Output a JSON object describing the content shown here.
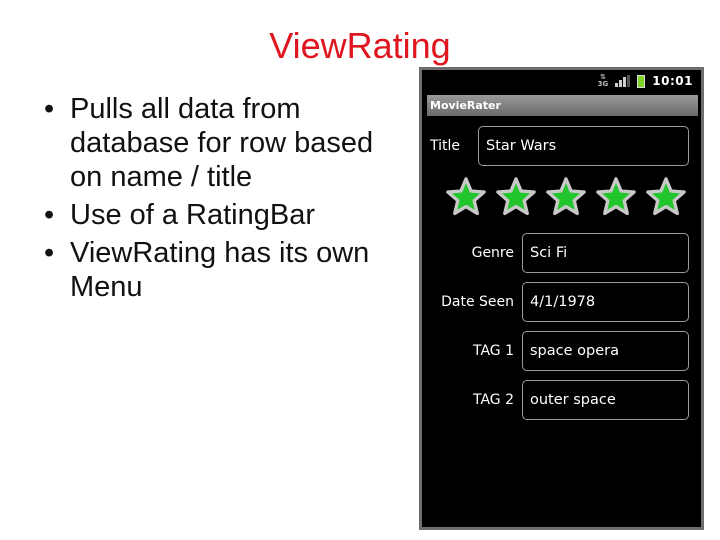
{
  "slide": {
    "title": "ViewRating",
    "bullet_glyph": "•",
    "bullets": [
      "Pulls all data from database for row based on name / title",
      "Use of a RatingBar",
      "ViewRating has its own Menu"
    ]
  },
  "phone": {
    "status_bar": {
      "network_label": "3G",
      "clock": "10:01"
    },
    "app_title": "MovieRater",
    "title_field": {
      "label": "Title",
      "value": "Star Wars"
    },
    "rating": {
      "value": 5,
      "max": 5,
      "star_color": "#22c52b"
    },
    "fields": [
      {
        "label": "Genre",
        "value": "Sci Fi"
      },
      {
        "label": "Date Seen",
        "value": "4/1/1978"
      },
      {
        "label": "TAG 1",
        "value": "space opera"
      },
      {
        "label": "TAG 2",
        "value": "outer space"
      }
    ]
  },
  "colors": {
    "title_red": "#e0161f",
    "phone_frame": "#6e6e6e"
  }
}
